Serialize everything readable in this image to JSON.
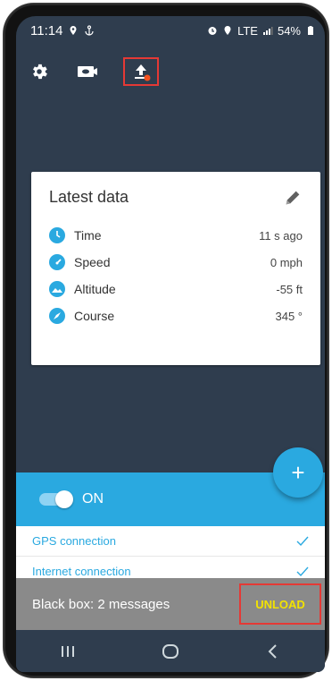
{
  "status_bar": {
    "time": "11:14",
    "network": "LTE",
    "battery": "54%"
  },
  "toolbar": {
    "settings_icon": "gear-icon",
    "camera_icon": "camera-icon",
    "upload_icon": "upload-icon",
    "upload_badge_color": "#f4511e"
  },
  "card": {
    "title": "Latest data",
    "rows": [
      {
        "label": "Time",
        "value": "11 s ago",
        "icon": "clock-icon"
      },
      {
        "label": "Speed",
        "value": "0 mph",
        "icon": "speedometer-icon"
      },
      {
        "label": "Altitude",
        "value": "-55 ft",
        "icon": "mountain-icon"
      },
      {
        "label": "Course",
        "value": "345 °",
        "icon": "compass-icon"
      }
    ]
  },
  "switch": {
    "label": "ON"
  },
  "fab": {
    "label": "+"
  },
  "connections": [
    {
      "label": "GPS connection"
    },
    {
      "label": "Internet connection"
    }
  ],
  "snackbar": {
    "message": "Black box: 2 messages",
    "action": "UNLOAD"
  },
  "colors": {
    "background": "#2f3d4e",
    "accent": "#2aa9e0",
    "snackbar_action": "#f2e200",
    "highlight_box": "#e53935"
  }
}
